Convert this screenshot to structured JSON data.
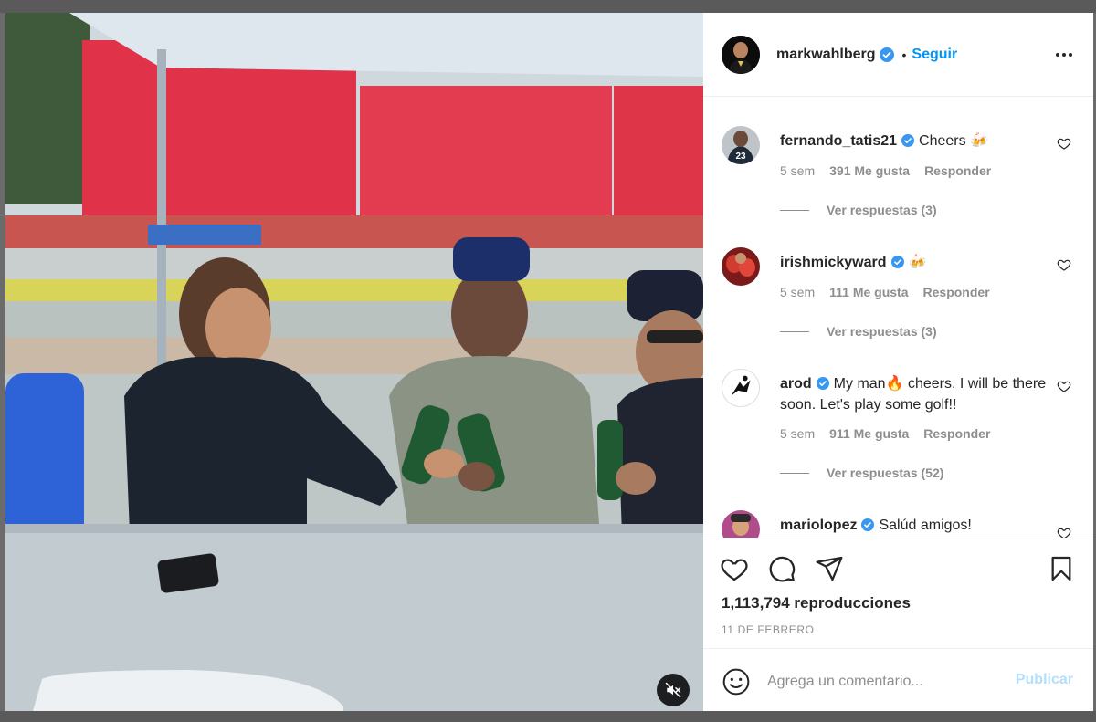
{
  "post": {
    "author": "markwahlberg",
    "author_verified": true,
    "separator": "•",
    "follow_label": "Seguir",
    "more_icon": "more-options-icon"
  },
  "comments": [
    {
      "user": "fernando_tatis21",
      "verified": true,
      "text": "Cheers 🍻",
      "time": "5 sem",
      "likes": "391 Me gusta",
      "reply_label": "Responder",
      "replies": "Ver respuestas (3)"
    },
    {
      "user": "irishmickyward",
      "verified": true,
      "text": "🍻",
      "time": "5 sem",
      "likes": "111 Me gusta",
      "reply_label": "Responder",
      "replies": "Ver respuestas (3)"
    },
    {
      "user": "arod",
      "verified": true,
      "text": "My man🔥 cheers. I will be there soon. Let's play some golf!!",
      "time": "5 sem",
      "likes": "911 Me gusta",
      "reply_label": "Responder",
      "replies": "Ver respuestas (52)"
    },
    {
      "user": "mariolopez",
      "verified": true,
      "text": "Salúd amigos!"
    }
  ],
  "actions": {
    "views": "1,113,794 reproducciones",
    "date": "11 DE FEBRERO"
  },
  "add_comment": {
    "placeholder": "Agrega un comentario...",
    "publish_label": "Publicar"
  },
  "colors": {
    "accent": "#0095f6",
    "verified": "#3897f0",
    "muted_text": "#8e8e8e",
    "publish_disabled": "#b2dffc"
  }
}
